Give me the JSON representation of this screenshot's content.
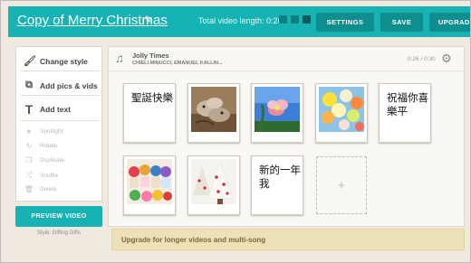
{
  "header": {
    "title": "Copy of Merry Christmas",
    "video_length": "Total video length: 0:26",
    "settings_label": "SETTINGS",
    "save_label": "SAVE",
    "upgrade_label": "UPGRADE"
  },
  "tools": {
    "change_style": "Change style",
    "add_pics": "Add pics & vids",
    "add_text": "Add text",
    "spotlight": "Spotlight",
    "rotate": "Rotate",
    "duplicate": "Duplicate",
    "shuffle": "Shuffle",
    "delete": "Delete"
  },
  "preview_label": "PREVIEW VIDEO",
  "style_label": "Style: Gifting Gifts",
  "music": {
    "song": "Jolly Times",
    "artist": "CHIELI MINUCCI, EMANUEL KALLIN...",
    "time": "0:26 / 0:30"
  },
  "tiles": {
    "text1": "聖誕快樂",
    "text2": "祝福你喜樂平",
    "text3": "新的一年 我"
  },
  "add_slot": "+",
  "upgrade_banner": "Upgrade for longer videos and multi-song",
  "colors": {
    "accent": "#17b2b3",
    "accent_dark": "#0e8e8f"
  }
}
